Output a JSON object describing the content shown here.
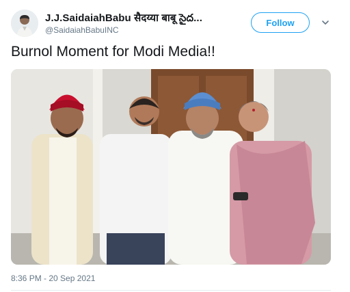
{
  "tweet": {
    "author_name": "J.J.SaidaiahBabu सैदय्या बाबू సైద...",
    "author_handle": "@SaidaiahBabuINC",
    "follow_label": "Follow",
    "text": "Burnol Moment for Modi Media!!",
    "timestamp": "8:36 PM - 20 Sep 2021"
  },
  "colors": {
    "accent": "#1da1f2",
    "secondary_text": "#657786",
    "primary_text": "#14171a"
  },
  "icons": {
    "more": "chevron-down-icon"
  }
}
